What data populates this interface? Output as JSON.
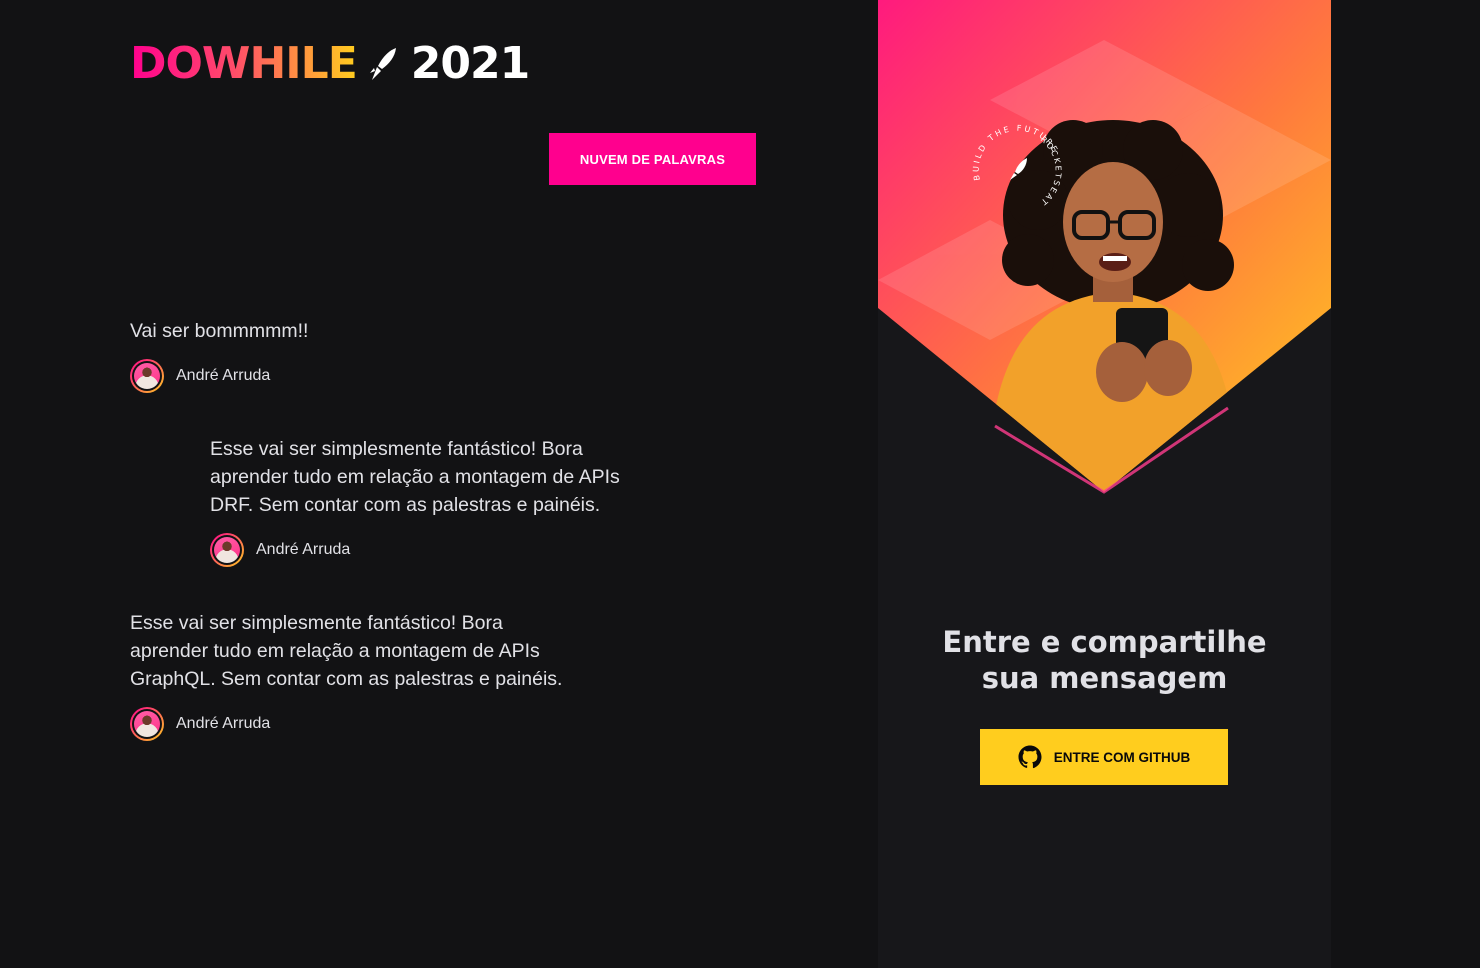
{
  "brand": {
    "name": "DOWHILE",
    "year": "2021"
  },
  "header": {
    "word_cloud_button": "NUVEM DE PALAVRAS"
  },
  "messages": [
    {
      "text": "Vai ser bommmmm!!",
      "user": "André Arruda"
    },
    {
      "text": "Esse vai ser simplesmente fantástico! Bora aprender tudo em relação a montagem de APIs DRF. Sem contar com as palestras e painéis.",
      "user": "André Arruda"
    },
    {
      "text": "Esse vai ser simplesmente fantástico! Bora aprender tudo em relação a montagem de APIs GraphQL. Sem contar com as palestras e painéis.",
      "user": "André Arruda"
    }
  ],
  "sidebar": {
    "badge_top": "BUILD THE FUTURE",
    "badge_side": "ROCKETSEAT",
    "cta_title_line1": "Entre e compartilhe",
    "cta_title_line2": "sua mensagem",
    "github_button": "ENTRE COM GITHUB"
  },
  "icons": {
    "rocket": "rocket-icon",
    "github": "github-icon",
    "avatar": "avatar"
  },
  "colors": {
    "background": "#121214",
    "panel": "#17171a",
    "pink": "#ff008e",
    "yellow": "#ffcd1e",
    "text": "#e1e1e6"
  }
}
